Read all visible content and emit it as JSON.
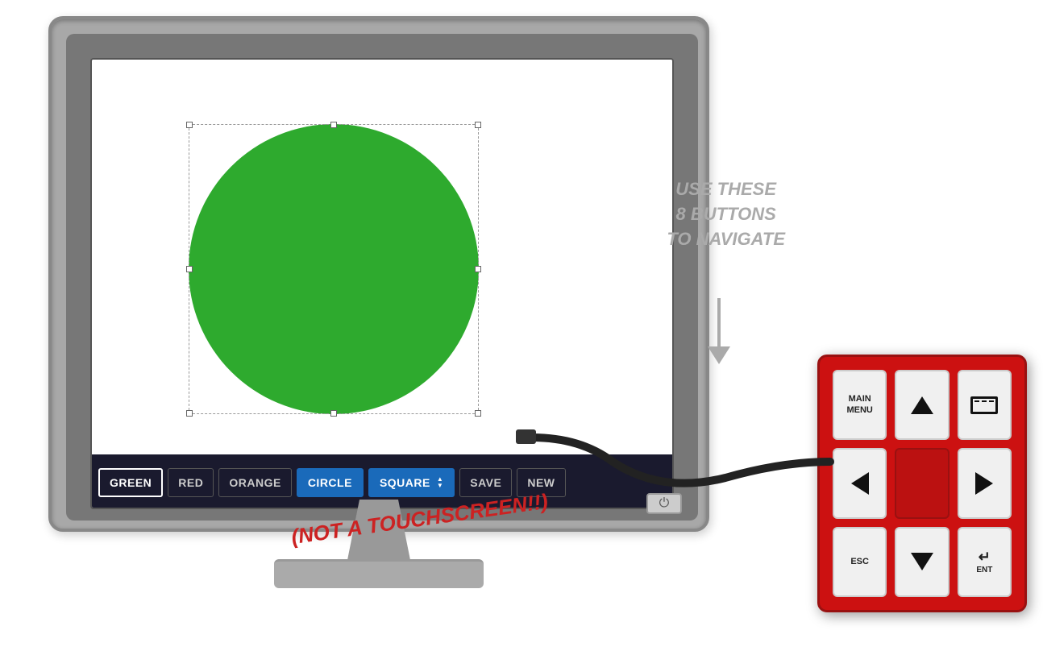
{
  "monitor": {
    "screen": {
      "shape": "circle",
      "shape_color": "#2eaa2e"
    },
    "toolbar": {
      "buttons": [
        {
          "label": "GREEN",
          "style": "active-outline",
          "id": "btn-green"
        },
        {
          "label": "RED",
          "style": "normal",
          "id": "btn-red"
        },
        {
          "label": "ORANGE",
          "style": "normal",
          "id": "btn-orange"
        },
        {
          "label": "CIRCLE",
          "style": "active-blue",
          "id": "btn-circle"
        },
        {
          "label": "SQUARE",
          "style": "active-blue-select",
          "id": "btn-square"
        },
        {
          "label": "SAVE",
          "style": "normal",
          "id": "btn-save"
        },
        {
          "label": "NEW",
          "style": "normal",
          "id": "btn-new"
        }
      ]
    },
    "not_touchscreen_label": "(NOT A TOUCHSCREEN!!)"
  },
  "instruction": {
    "line1": "USE THESE",
    "line2": "8 BUTTONS",
    "line3": "TO NAVIGATE"
  },
  "remote": {
    "buttons": [
      {
        "label": "MAIN\nMENU",
        "type": "text",
        "id": "btn-main-menu"
      },
      {
        "label": "up",
        "type": "arrow-up",
        "id": "btn-up"
      },
      {
        "label": "screen",
        "type": "screen-icon",
        "id": "btn-screen"
      },
      {
        "label": "left",
        "type": "arrow-left",
        "id": "btn-left"
      },
      {
        "label": "",
        "type": "empty",
        "id": "btn-center"
      },
      {
        "label": "right",
        "type": "arrow-right",
        "id": "btn-right"
      },
      {
        "label": "ESC",
        "type": "text",
        "id": "btn-esc"
      },
      {
        "label": "down",
        "type": "arrow-down",
        "id": "btn-down"
      },
      {
        "label": "ENT",
        "type": "ent",
        "id": "btn-ent"
      }
    ]
  }
}
